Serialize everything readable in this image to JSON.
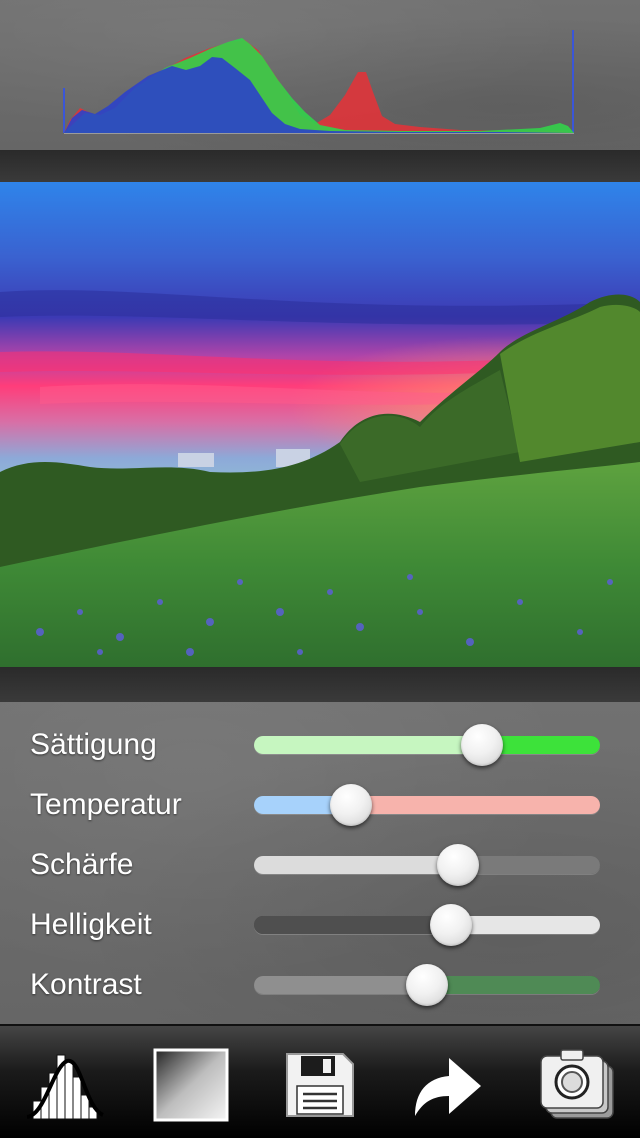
{
  "histogram": {
    "channels": [
      "blue",
      "green",
      "red"
    ],
    "colors": {
      "red": "#e0343a",
      "green": "#33d14a",
      "blue": "#2c43c9"
    }
  },
  "photo": {
    "subject": "sunset-meadow",
    "colors": {
      "sky_top": "#2f7fe6",
      "sky_mid": "#3b3fb8",
      "sunset": "#ff3d7a",
      "grass": "#4f9a3a"
    }
  },
  "adjustments": {
    "title": "",
    "sliders": [
      {
        "id": "saturation",
        "label": "Sättigung",
        "value": 0.66,
        "left_color": "#c6f6c0",
        "right_color": "#3de23a"
      },
      {
        "id": "temperature",
        "label": "Temperatur",
        "value": 0.28,
        "left_color": "#a7d2fb",
        "right_color": "#f7b3ac"
      },
      {
        "id": "sharpness",
        "label": "Schärfe",
        "value": 0.59,
        "left_color": "#dcdcdc",
        "right_color": "#7a7a7a"
      },
      {
        "id": "brightness",
        "label": "Helligkeit",
        "value": 0.57,
        "left_color": "#4f4f4f",
        "right_color": "#e6e6e6"
      },
      {
        "id": "contrast",
        "label": "Kontrast",
        "value": 0.5,
        "left_color": "#8f8f8f",
        "right_color": "#4f8a55"
      }
    ]
  },
  "toolbar": {
    "items": [
      {
        "id": "histogram",
        "icon": "histogram-icon"
      },
      {
        "id": "gradient",
        "icon": "gradient-icon"
      },
      {
        "id": "save",
        "icon": "floppy-disk-icon"
      },
      {
        "id": "share",
        "icon": "share-arrow-icon"
      },
      {
        "id": "photos",
        "icon": "camera-stack-icon"
      }
    ]
  }
}
